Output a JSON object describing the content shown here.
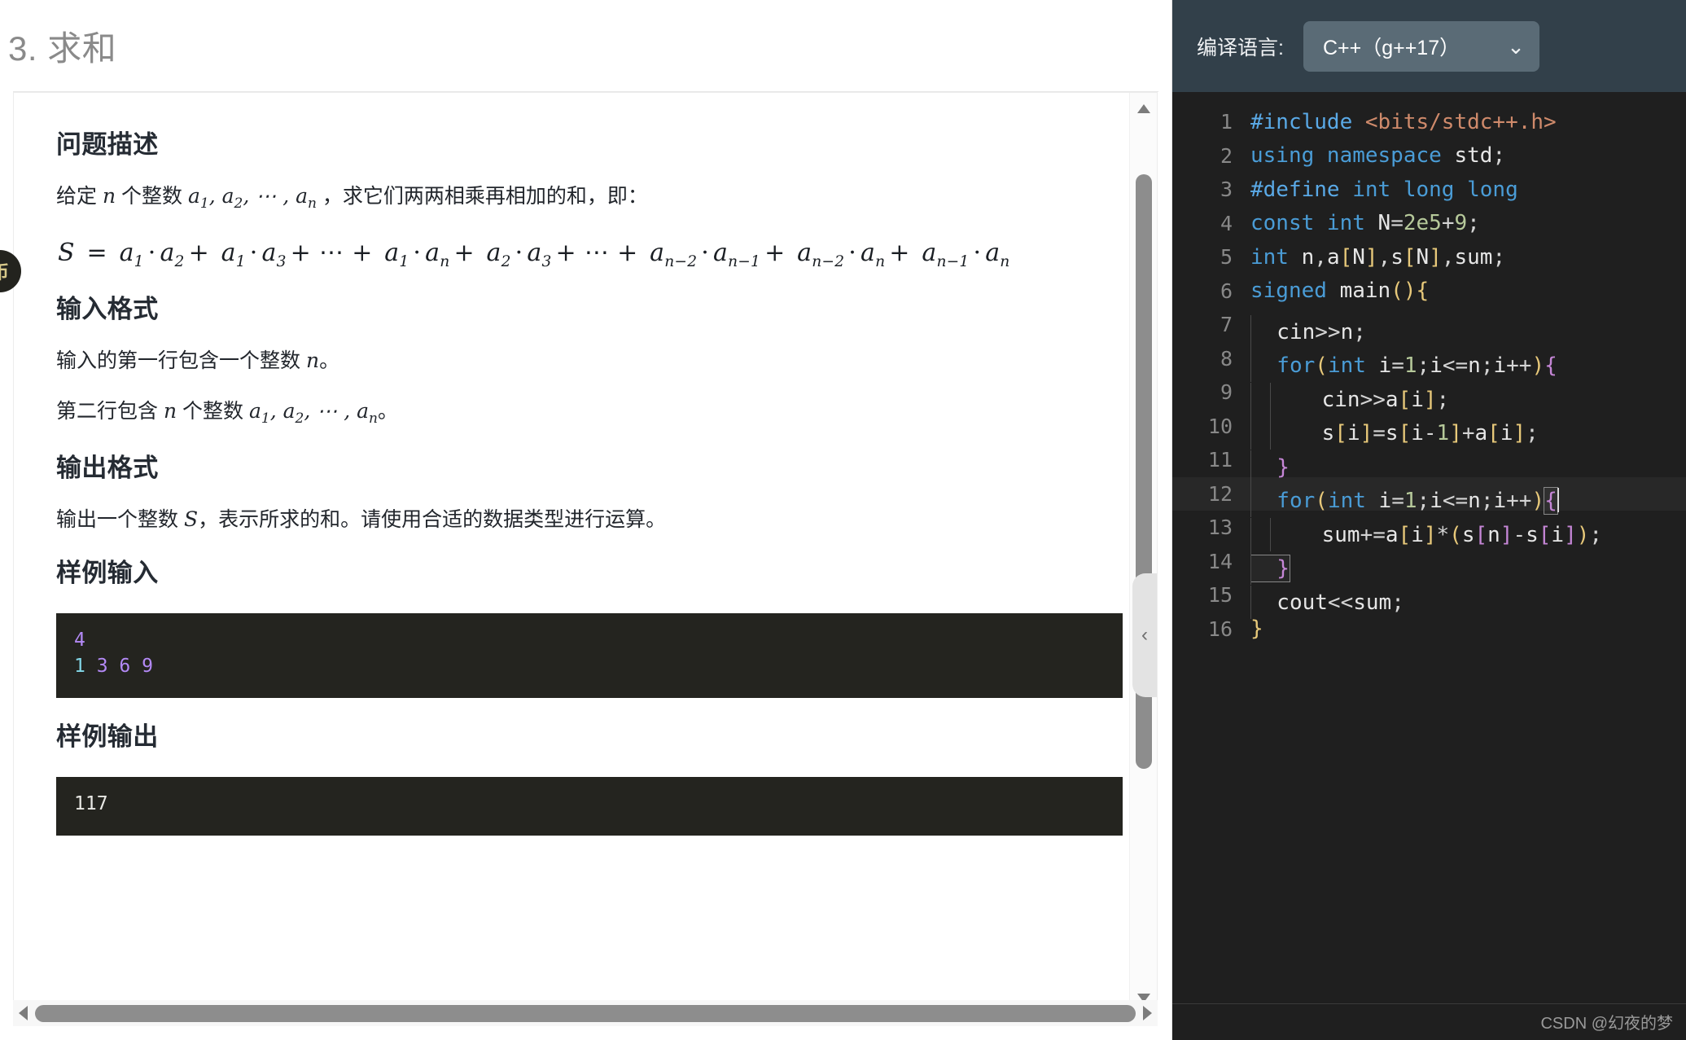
{
  "problem": {
    "title": "3. 求和",
    "sections": [
      {
        "heading": "问题描述"
      },
      {
        "heading": "输入格式"
      },
      {
        "heading": "输出格式"
      },
      {
        "heading": "样例输入"
      },
      {
        "heading": "样例输出"
      }
    ],
    "description_text_1": "给定",
    "description_text_2": "个整数",
    "description_text_3": "，求它们两两相乘再相加的和，即：",
    "formula": "S = a₁·a₂ + a₁·a₃ + ⋯ + a₁·aₙ + a₂·a₃ + ⋯ + aₙ₋₂·aₙ₋₁ + aₙ₋₂·aₙ + aₙ₋₁·aₙ",
    "input_line_1_a": "输入的第一行包含一个整数",
    "input_line_1_b": "。",
    "input_line_2_a": "第二行包含",
    "input_line_2_b": "个整数",
    "input_line_2_c": "。",
    "output_line_a": "输出一个整数",
    "output_line_b": "，表示所求的和。请使用合适的数据类型进行运算。",
    "sample_input": [
      {
        "tokens": [
          {
            "text": "4",
            "color": "purple"
          }
        ]
      },
      {
        "tokens": [
          {
            "text": "1",
            "color": "cyan"
          },
          {
            "text": " 3 6 9",
            "color": "purple"
          }
        ]
      }
    ],
    "sample_output": [
      {
        "tokens": [
          {
            "text": "117",
            "color": "plain"
          }
        ]
      }
    ]
  },
  "editor": {
    "lang_label": "编译语言:",
    "lang_value": "C++（g++17）",
    "chevron": "⌄",
    "lines": [
      {
        "no": "1",
        "text": "#include <bits/stdc++.h>"
      },
      {
        "no": "2",
        "text": "using namespace std;"
      },
      {
        "no": "3",
        "text": "#define int long long"
      },
      {
        "no": "4",
        "text": "const int N=2e5+9;"
      },
      {
        "no": "5",
        "text": "int n,a[N],s[N],sum;"
      },
      {
        "no": "6",
        "text": "signed main(){"
      },
      {
        "no": "7",
        "text": "  cin>>n;"
      },
      {
        "no": "8",
        "text": "  for(int i=1;i<=n;i++){"
      },
      {
        "no": "9",
        "text": "    cin>>a[i];"
      },
      {
        "no": "10",
        "text": "    s[i]=s[i-1]+a[i];"
      },
      {
        "no": "11",
        "text": "  }"
      },
      {
        "no": "12",
        "text": "  for(int i=1;i<=n;i++){"
      },
      {
        "no": "13",
        "text": "    sum+=a[i]*(s[n]-s[i]);"
      },
      {
        "no": "14",
        "text": "  }"
      },
      {
        "no": "15",
        "text": "  cout<<sum;"
      },
      {
        "no": "16",
        "text": "}"
      }
    ],
    "active_line": "12",
    "watermark": "CSDN @幻夜的梦"
  },
  "controls": {
    "collapse_glyph": "‹",
    "scroll_up_label": "scroll-up",
    "scroll_down_label": "scroll-down"
  },
  "colors": {
    "header_bg": "#32404a",
    "select_bg": "#5a6b76",
    "editor_bg": "#1f1f1f",
    "code_block_bg": "#24241f",
    "purple": "#b389f5",
    "cyan": "#83d7e8"
  }
}
